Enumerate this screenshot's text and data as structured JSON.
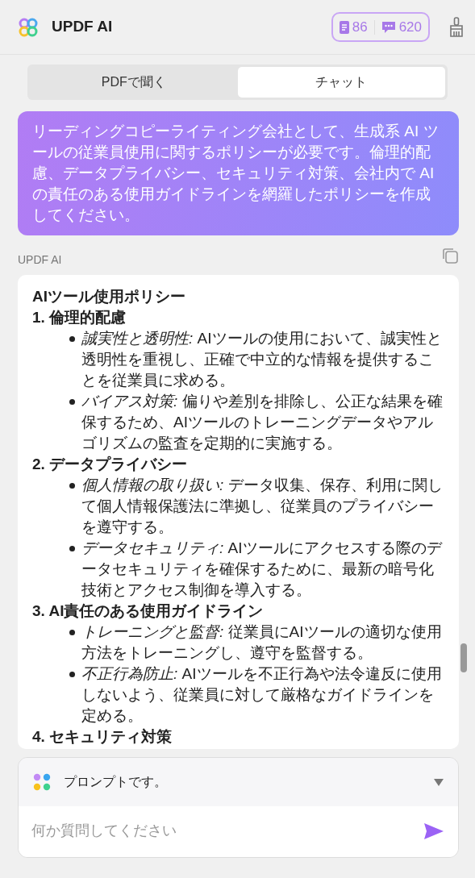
{
  "header": {
    "title": "UPDF AI",
    "credits": [
      {
        "kind": "document",
        "count": "86"
      },
      {
        "kind": "chat",
        "count": "620"
      }
    ]
  },
  "tabs": [
    {
      "label": "PDFで聞く",
      "selected": false
    },
    {
      "label": "チャット",
      "selected": true
    }
  ],
  "user_message": "リーディングコピーライティング会社として、生成系 AI ツールの従業員使用に関するポリシーが必要です。倫理的配慮、データプライバシー、セキュリティ対策、会社内で AI の責任のある使用ガイドラインを網羅したポリシーを作成してください。",
  "reply": {
    "sender": "UPDF AI",
    "title": "AIツール使用ポリシー",
    "sections": [
      {
        "heading": "1. 倫理的配慮",
        "items": [
          {
            "term": "誠実性と透明性:",
            "text": " AIツールの使用において、誠実性と透明性を重視し、正確で中立的な情報を提供することを従業員に求める。"
          },
          {
            "term": "バイアス対策:",
            "text": " 偏りや差別を排除し、公正な結果を確保するため、AIツールのトレーニングデータやアルゴリズムの監査を定期的に実施する。"
          }
        ]
      },
      {
        "heading": "2. データプライバシー",
        "items": [
          {
            "term": "個人情報の取り扱い:",
            "text": " データ収集、保存、利用に関して個人情報保護法に準拠し、従業員のプライバシーを遵守する。"
          },
          {
            "term": "データセキュリティ:",
            "text": " AIツールにアクセスする際のデータセキュリティを確保するために、最新の暗号化技術とアクセス制御を導入する。"
          }
        ]
      },
      {
        "heading": "3. AI責任のある使用ガイドライン",
        "items": [
          {
            "term": "トレーニングと監督:",
            "text": " 従業員にAIツールの適切な使用方法をトレーニングし、遵守を監督する。"
          },
          {
            "term": "不正行為防止:",
            "text": " AIツールを不正行為や法令違反に使用しないよう、従業員に対して厳格なガイドラインを定める。"
          }
        ]
      },
      {
        "heading": "4. セキュリティ対策"
      }
    ]
  },
  "prompt_selector": "プロンプトです。",
  "input": {
    "placeholder": "何か質問してください"
  }
}
